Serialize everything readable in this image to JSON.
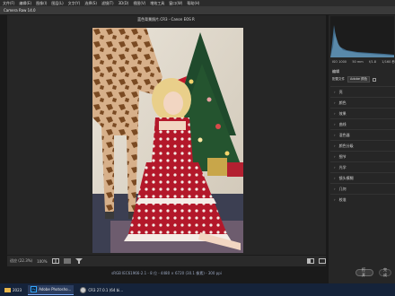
{
  "menubar": {
    "items": [
      "文件(F)",
      "编辑(E)",
      "图像(I)",
      "图层(L)",
      "文字(Y)",
      "选择(S)",
      "滤镜(T)",
      "3D(D)",
      "视图(V)",
      "增效工具",
      "窗口(W)",
      "帮助(H)"
    ]
  },
  "window": {
    "title": "Camera Raw 14.0"
  },
  "canvas": {
    "filename": "蓝色背景照片.CR3 - Canon EOS R"
  },
  "bottombar": {
    "zoom": "适应 (22.3%)",
    "zoom_level": "100%"
  },
  "info": {
    "text": "sRGB IEC61966-2.1 - 8 位 - 4480 × 6720 (30.1 像素) - 300 ppi"
  },
  "right": {
    "meta_left": "ISO 1000",
    "meta_mid": "50 mm",
    "meta_fstop": "f/1.8",
    "meta_shutter": "1/160 秒",
    "profile_label": "配置文件",
    "profile_value": "Adobe 颜色",
    "section_label": "编辑",
    "panels": [
      "亮",
      "颜色",
      "效果",
      "曲线",
      "混色器",
      "颜色分级",
      "细节",
      "光学",
      "镜头模糊",
      "几何",
      "校准"
    ]
  },
  "buttons": {
    "open": "打开",
    "done": "完成"
  },
  "taskbar": {
    "items": [
      "2023",
      "Adobe Photosho...",
      "CR3 27.0.1 (64 bi..."
    ]
  },
  "colors": {
    "accent": "#31a8ff",
    "taskbar": "#15233a",
    "dress": "#b3182a"
  },
  "icons": [
    "zoom-icon",
    "grid-icon",
    "before-after-icon",
    "filter-icon",
    "histogram-icon",
    "chevron-right-icon",
    "photoshop-icon",
    "folder-icon",
    "chrome-icon"
  ]
}
